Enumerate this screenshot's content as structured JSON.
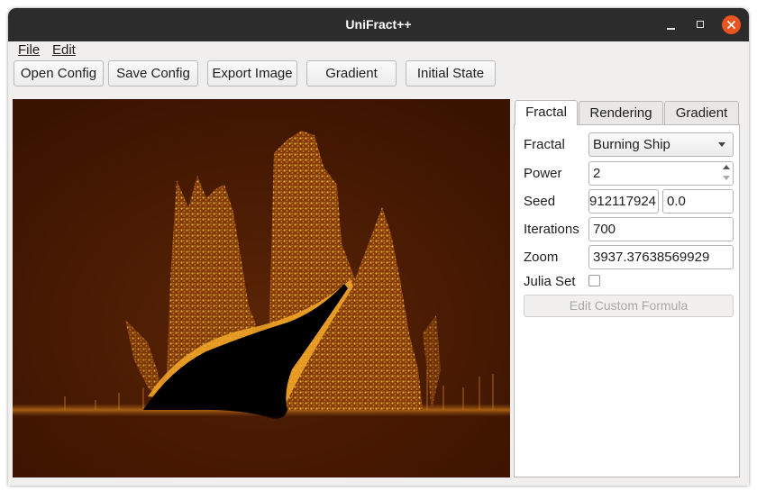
{
  "window": {
    "title": "UniFract++"
  },
  "menu": {
    "file": "File",
    "edit": "Edit"
  },
  "toolbar": {
    "open_config": "Open Config",
    "save_config": "Save Config",
    "export_image": "Export Image",
    "gradient": "Gradient",
    "initial_state": "Initial State"
  },
  "tabs": {
    "fractal": "Fractal",
    "rendering": "Rendering",
    "gradient": "Gradient"
  },
  "fractal_panel": {
    "fractal_label": "Fractal",
    "fractal_value": "Burning Ship",
    "power_label": "Power",
    "power_value": "2",
    "seed_label": "Seed",
    "seed_x": "912117924",
    "seed_y": "0.0",
    "iterations_label": "Iterations",
    "iterations_value": "700",
    "zoom_label": "Zoom",
    "zoom_value": "3937.37638569929",
    "julia_label": "Julia Set",
    "julia_checked": false,
    "edit_formula_label": "Edit Custom Formula"
  },
  "colors": {
    "accent_close": "#e95420",
    "titlebar": "#2c2c2c",
    "fractal_bg": "#3d1400",
    "fractal_glow": "#f0a020"
  },
  "icons": {
    "minimize": "minimize-icon",
    "maximize": "maximize-icon",
    "close": "close-icon",
    "dropdown": "chevron-down-icon"
  }
}
